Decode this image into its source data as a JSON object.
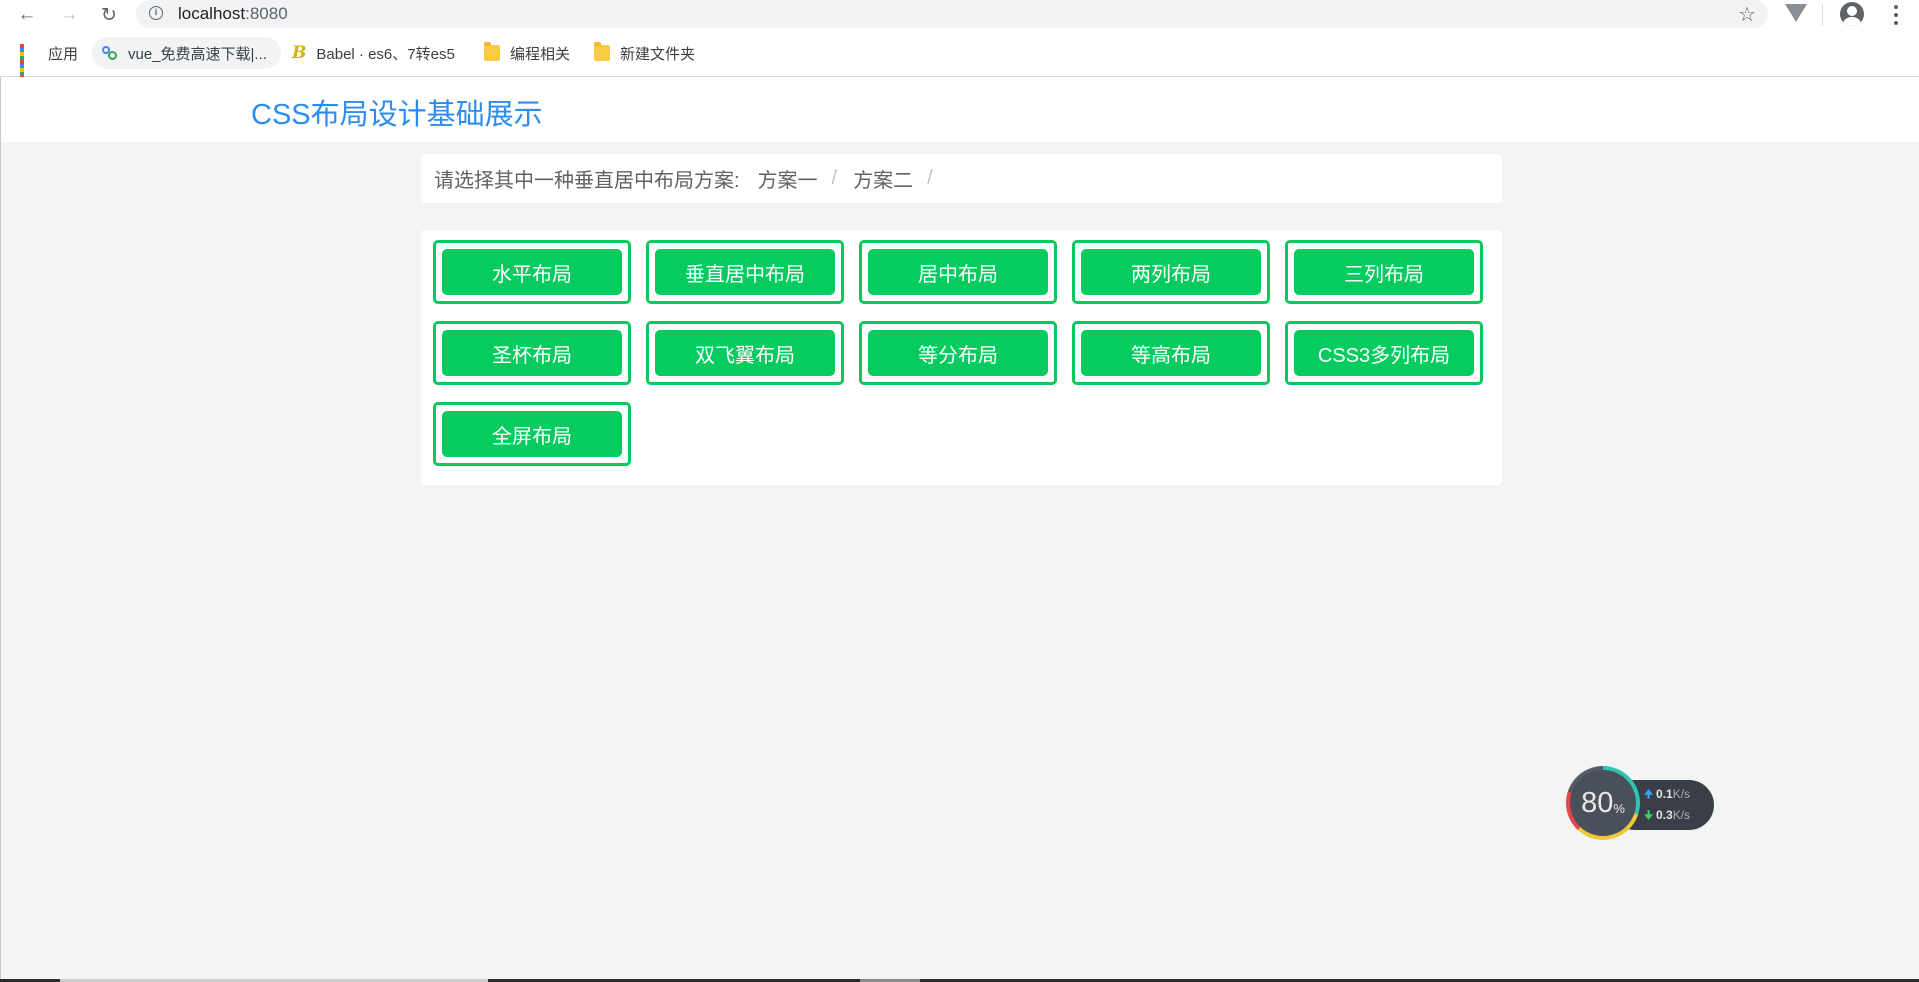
{
  "browser": {
    "url_host": "localhost",
    "url_port": ":8080",
    "bookmarks": [
      {
        "label": "应用",
        "icon": "apps-grid-icon"
      },
      {
        "label": "vue_免费高速下载|...",
        "icon": "baidu-cloud-icon"
      },
      {
        "label": "Babel · es6、7转es5",
        "icon": "babel-icon"
      },
      {
        "label": "编程相关",
        "icon": "folder-icon"
      },
      {
        "label": "新建文件夹",
        "icon": "folder-icon"
      }
    ]
  },
  "header": {
    "title": "CSS布局设计基础展示"
  },
  "breadcrumb": {
    "prompt": "请选择其中一种垂直居中布局方案:",
    "items": [
      "方案一",
      "方案二"
    ],
    "separator": "/"
  },
  "layout_buttons": [
    "水平布局",
    "垂直居中布局",
    "居中布局",
    "两列布局",
    "三列布局",
    "圣杯布局",
    "双飞翼布局",
    "等分布局",
    "等高布局",
    "CSS3多列布局",
    "全屏布局"
  ],
  "network_widget": {
    "percent": "80",
    "percent_unit": "%",
    "upload_value": "0.1",
    "download_value": "0.3",
    "unit": "K/s"
  },
  "colors": {
    "title_blue": "#2d8cf0",
    "button_green": "#06cc60",
    "page_bg": "#f3f5f4"
  }
}
